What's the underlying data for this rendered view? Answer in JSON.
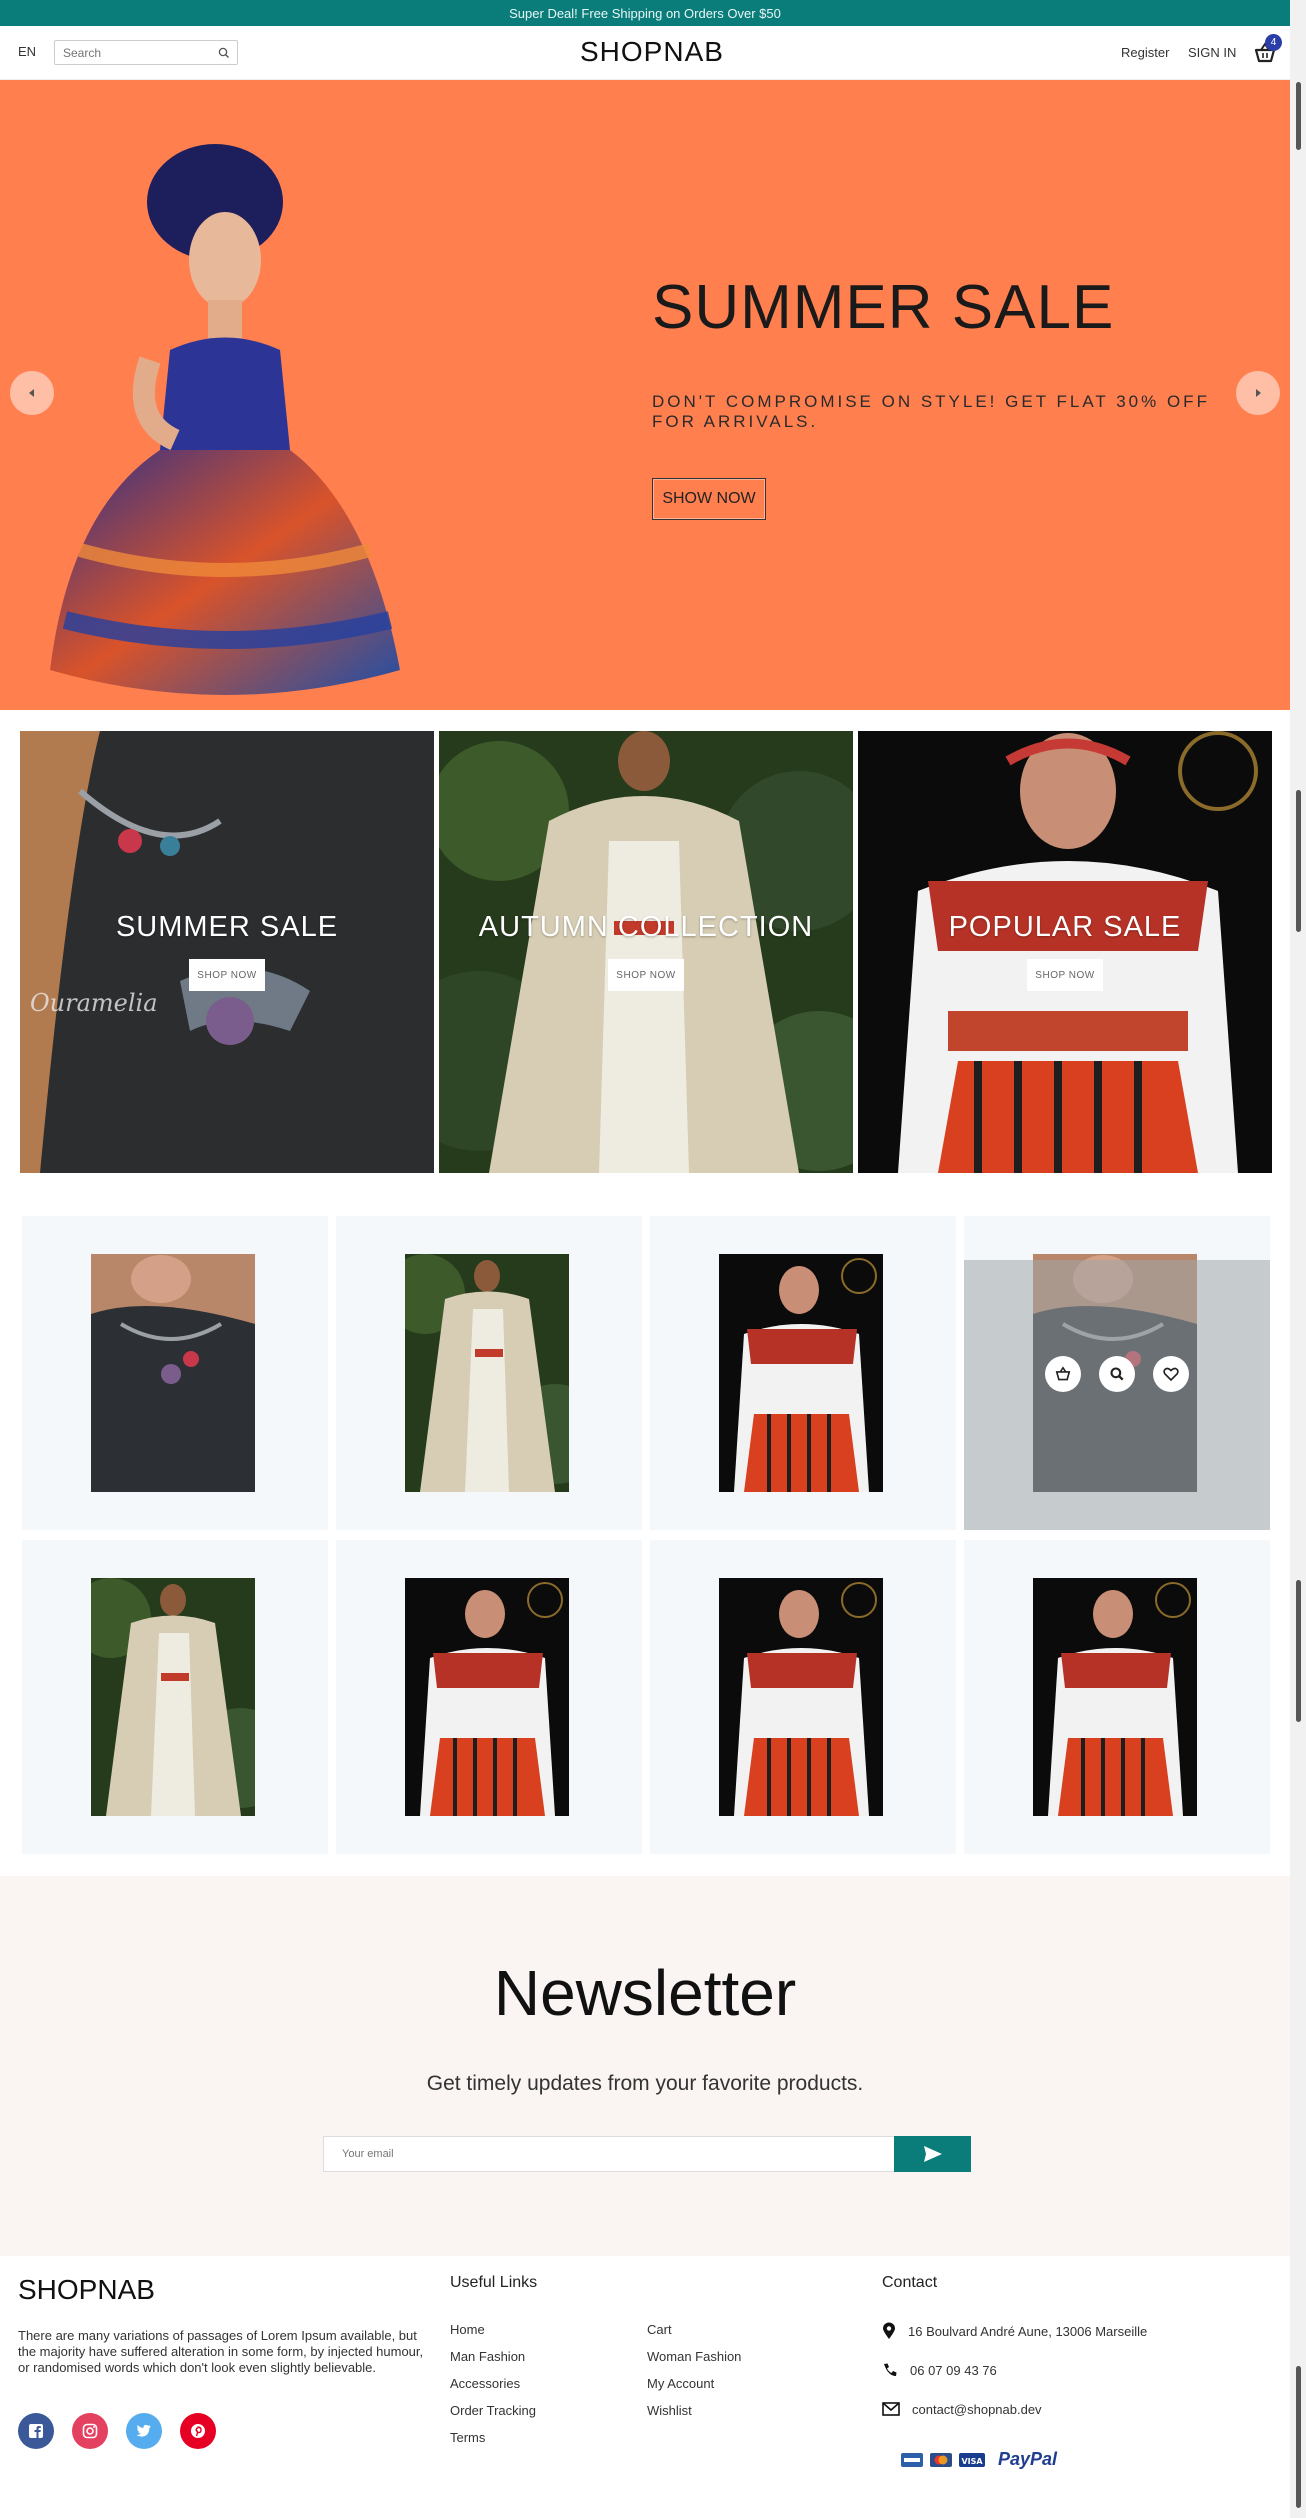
{
  "topbar": {
    "text": "Super Deal! Free Shipping on Orders Over $50"
  },
  "header": {
    "lang": "EN",
    "search_placeholder": "Search",
    "logo": "SHOPNAB",
    "register": "Register",
    "signin": "SIGN IN",
    "cart_count": "4"
  },
  "hero": {
    "title": "SUMMER SALE",
    "subtitle": "DON'T COMPROMISE ON STYLE! GET FLAT 30% OFF FOR ARRIVALS.",
    "button": "SHOW NOW",
    "bg_color": "#ff7f4f"
  },
  "banners": [
    {
      "title": "SUMMER SALE",
      "button": "SHOP NOW"
    },
    {
      "title": "AUTUMN COLLECTION",
      "button": "SHOP NOW"
    },
    {
      "title": "POPULAR SALE",
      "button": "SHOP NOW"
    }
  ],
  "newsletter": {
    "title": "Newsletter",
    "subtitle": "Get timely updates from your favorite products.",
    "placeholder": "Your email"
  },
  "footer": {
    "logo": "SHOPNAB",
    "about": "There are many variations of passages of Lorem Ipsum available, but the majority have suffered alteration in some form, by injected humour, or randomised words which don't look even slightly believable.",
    "useful_links_title": "Useful Links",
    "links_col1": [
      "Home",
      "Man Fashion",
      "Accessories",
      "Order Tracking",
      "Terms"
    ],
    "links_col2": [
      "Cart",
      "Woman Fashion",
      "My Account",
      "Wishlist"
    ],
    "contact_title": "Contact",
    "address": "16 Boulvard André Aune, 13006 Marseille",
    "phone": "06 07 09 43 76",
    "email": "contact@shopnab.dev",
    "paypal": "PayPal",
    "visa": "VISA"
  },
  "colors": {
    "accent": "#0a7d7a",
    "badge": "#2b3ea8",
    "facebook": "#3b5998",
    "instagram": "#e4405f",
    "twitter": "#55acee",
    "pinterest": "#e60023"
  }
}
